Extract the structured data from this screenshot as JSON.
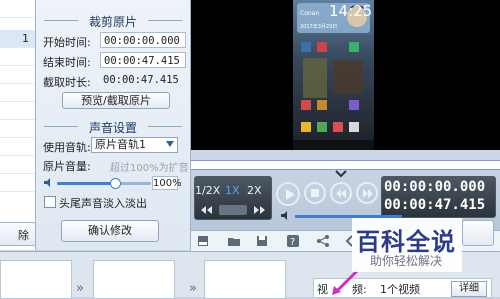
{
  "left_list": {
    "selected_suffix": "1",
    "delete_button": "除"
  },
  "crop": {
    "title": "裁剪原片",
    "start_label": "开始时间:",
    "start_value": "00:00:00.000",
    "end_label": "结束时间:",
    "end_value": "00:00:47.415",
    "duration_label": "截取时长:",
    "duration_value": "00:00:47.415",
    "preview_button": "预览/截取原片"
  },
  "audio": {
    "title": "声音设置",
    "track_label": "使用音轨:",
    "track_value": "原片音轨1",
    "volume_label": "原片音量:",
    "volume_hint": "超过100%为扩音",
    "volume_value": "100%",
    "volume_fraction": 0.62,
    "fade_label": "头尾声音淡入淡出",
    "fade_checked": false,
    "confirm_button": "确认修改"
  },
  "video": {
    "status_time": "14:25",
    "status_name": "Conan",
    "status_date": "2017年3月29日"
  },
  "player": {
    "speed_half": "1/2X",
    "speed_1x": "1X",
    "speed_2x": "2X",
    "current_time": "00:00:00.000",
    "total_time": "00:00:47.415",
    "volume_fraction": 0.55
  },
  "bottom": {
    "info_label": "视",
    "info_label2": "频:",
    "info_value": "1个视频",
    "detail_button": "详细"
  },
  "watermark": {
    "main": "百科全说",
    "sub": "助你轻松解决"
  },
  "colors": {
    "accent": "#3e7fd3",
    "panel_title": "#1a3a64",
    "watermark": "#2d3b8f"
  }
}
